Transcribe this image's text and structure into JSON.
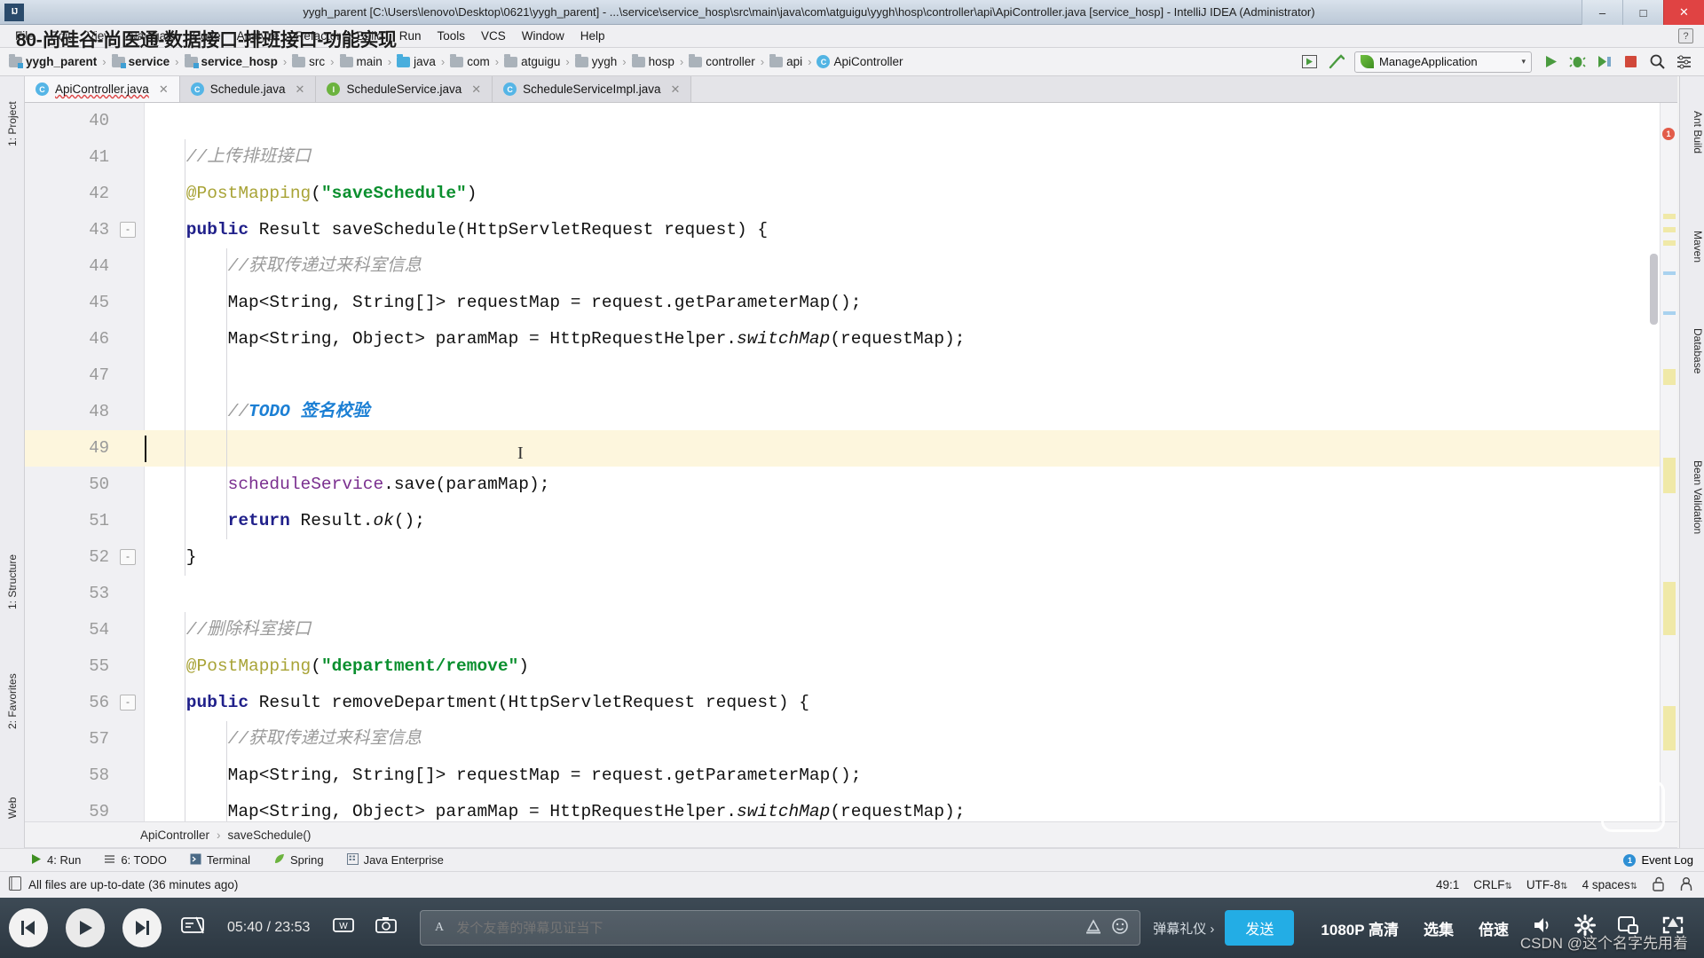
{
  "window": {
    "title": "yygh_parent [C:\\Users\\lenovo\\Desktop\\0621\\yygh_parent] - ...\\service\\service_hosp\\src\\main\\java\\com\\atguigu\\yygh\\hosp\\controller\\api\\ApiController.java [service_hosp] - IntelliJ IDEA (Administrator)",
    "app_icon": "IJ",
    "minimize": "–",
    "maximize": "□",
    "close": "✕"
  },
  "menubar": {
    "items": [
      "File",
      "Edit",
      "View",
      "Navigate",
      "Code",
      "Analyze",
      "Refactor",
      "Build",
      "Run",
      "Tools",
      "VCS",
      "Window",
      "Help"
    ],
    "help_icon": "?"
  },
  "video_overlay": {
    "title": "80-尚硅谷-尚医通-数据接口-排班接口-功能实现"
  },
  "navbar": {
    "crumbs": [
      {
        "label": "yygh_parent",
        "icon": "folder-module-icon",
        "bold": true,
        "style": "module"
      },
      {
        "label": "service",
        "icon": "folder-module-icon",
        "bold": true,
        "style": "module"
      },
      {
        "label": "service_hosp",
        "icon": "folder-module-icon",
        "bold": true,
        "style": "module"
      },
      {
        "label": "src",
        "icon": "folder-icon",
        "bold": false,
        "style": "plain"
      },
      {
        "label": "main",
        "icon": "folder-icon",
        "bold": false,
        "style": "plain"
      },
      {
        "label": "java",
        "icon": "folder-source-icon",
        "bold": false,
        "style": "source"
      },
      {
        "label": "com",
        "icon": "folder-icon",
        "bold": false,
        "style": "plain"
      },
      {
        "label": "atguigu",
        "icon": "folder-icon",
        "bold": false,
        "style": "plain"
      },
      {
        "label": "yygh",
        "icon": "folder-icon",
        "bold": false,
        "style": "plain"
      },
      {
        "label": "hosp",
        "icon": "folder-icon",
        "bold": false,
        "style": "plain"
      },
      {
        "label": "controller",
        "icon": "folder-icon",
        "bold": false,
        "style": "plain"
      },
      {
        "label": "api",
        "icon": "folder-icon",
        "bold": false,
        "style": "plain"
      },
      {
        "label": "ApiController",
        "icon": "java-class-icon",
        "bold": false,
        "style": "class"
      }
    ],
    "separator": "›",
    "run_config": "ManageApplication",
    "run_config_chevron": "▾",
    "class_letter": "C"
  },
  "editor_tabs": [
    {
      "label": "ApiController.java",
      "icon": "java-class-icon",
      "icon_letter": "C",
      "active": true,
      "close": "✕"
    },
    {
      "label": "Schedule.java",
      "icon": "java-class-icon",
      "icon_letter": "C",
      "active": false,
      "close": "✕"
    },
    {
      "label": "ScheduleService.java",
      "icon": "java-interface-icon",
      "icon_letter": "I",
      "active": false,
      "close": "✕"
    },
    {
      "label": "ScheduleServiceImpl.java",
      "icon": "java-class-icon",
      "icon_letter": "C",
      "active": false,
      "close": "✕"
    }
  ],
  "left_strip": [
    {
      "label": "1: Project"
    },
    {
      "label": "1: Structure"
    },
    {
      "label": "2: Favorites"
    },
    {
      "label": "Web"
    }
  ],
  "right_strip": [
    {
      "label": "Ant Build"
    },
    {
      "label": "Maven"
    },
    {
      "label": "Database"
    },
    {
      "label": "Bean Validation"
    }
  ],
  "code": {
    "first_line": 40,
    "error_count": "1",
    "lines": [
      {
        "no": "40",
        "fold": null,
        "highlight": false,
        "indent": 0,
        "tokens": []
      },
      {
        "no": "41",
        "fold": null,
        "highlight": false,
        "indent": 1,
        "tokens": [
          {
            "t": "comment",
            "s": "    //上传排班接口"
          }
        ]
      },
      {
        "no": "42",
        "fold": null,
        "highlight": false,
        "indent": 1,
        "tokens": [
          {
            "t": "ann",
            "s": "    @PostMapping"
          },
          {
            "t": "plain",
            "s": "("
          },
          {
            "t": "str",
            "s": "\"saveSchedule\""
          },
          {
            "t": "plain",
            "s": ")"
          }
        ]
      },
      {
        "no": "43",
        "fold": "-",
        "highlight": false,
        "indent": 1,
        "tokens": [
          {
            "t": "kw",
            "s": "    public"
          },
          {
            "t": "plain",
            "s": " Result saveSchedule(HttpServletRequest request) {"
          }
        ]
      },
      {
        "no": "44",
        "fold": null,
        "highlight": false,
        "indent": 2,
        "tokens": [
          {
            "t": "comment",
            "s": "        //获取传递过来科室信息"
          }
        ]
      },
      {
        "no": "45",
        "fold": null,
        "highlight": false,
        "indent": 2,
        "tokens": [
          {
            "t": "plain",
            "s": "        Map<String, String[]> requestMap = request.getParameterMap();"
          }
        ]
      },
      {
        "no": "46",
        "fold": null,
        "highlight": false,
        "indent": 2,
        "tokens": [
          {
            "t": "plain",
            "s": "        Map<String, Object> paramMap = HttpRequestHelper."
          },
          {
            "t": "static",
            "s": "switchMap"
          },
          {
            "t": "plain",
            "s": "(requestMap);"
          }
        ]
      },
      {
        "no": "47",
        "fold": null,
        "highlight": false,
        "indent": 2,
        "tokens": []
      },
      {
        "no": "48",
        "fold": null,
        "highlight": false,
        "indent": 2,
        "tokens": [
          {
            "t": "comment",
            "s": "        //"
          },
          {
            "t": "todo",
            "s": "TODO 签名校验"
          }
        ]
      },
      {
        "no": "49",
        "fold": null,
        "highlight": true,
        "indent": 2,
        "caret": true,
        "tokens": []
      },
      {
        "no": "50",
        "fold": null,
        "highlight": false,
        "indent": 2,
        "tokens": [
          {
            "t": "field",
            "s": "        scheduleService"
          },
          {
            "t": "plain",
            "s": "."
          },
          {
            "t": "method",
            "s": "save"
          },
          {
            "t": "plain",
            "s": "(paramMap);"
          }
        ]
      },
      {
        "no": "51",
        "fold": null,
        "highlight": false,
        "indent": 2,
        "tokens": [
          {
            "t": "kw",
            "s": "        return"
          },
          {
            "t": "plain",
            "s": " Result."
          },
          {
            "t": "static",
            "s": "ok"
          },
          {
            "t": "plain",
            "s": "();"
          }
        ]
      },
      {
        "no": "52",
        "fold": "-",
        "highlight": false,
        "indent": 1,
        "tokens": [
          {
            "t": "plain",
            "s": "    }"
          }
        ]
      },
      {
        "no": "53",
        "fold": null,
        "highlight": false,
        "indent": 0,
        "tokens": []
      },
      {
        "no": "54",
        "fold": null,
        "highlight": false,
        "indent": 1,
        "tokens": [
          {
            "t": "comment",
            "s": "    //删除科室接口"
          }
        ]
      },
      {
        "no": "55",
        "fold": null,
        "highlight": false,
        "indent": 1,
        "tokens": [
          {
            "t": "ann",
            "s": "    @PostMapping"
          },
          {
            "t": "plain",
            "s": "("
          },
          {
            "t": "str",
            "s": "\"department/remove\""
          },
          {
            "t": "plain",
            "s": ")"
          }
        ]
      },
      {
        "no": "56",
        "fold": "-",
        "highlight": false,
        "indent": 1,
        "tokens": [
          {
            "t": "kw",
            "s": "    public"
          },
          {
            "t": "plain",
            "s": " Result removeDepartment(HttpServletRequest request) {"
          }
        ]
      },
      {
        "no": "57",
        "fold": null,
        "highlight": false,
        "indent": 2,
        "tokens": [
          {
            "t": "comment",
            "s": "        //获取传递过来科室信息"
          }
        ]
      },
      {
        "no": "58",
        "fold": null,
        "highlight": false,
        "indent": 2,
        "tokens": [
          {
            "t": "plain",
            "s": "        Map<String, String[]> requestMap = request.getParameterMap();"
          }
        ]
      },
      {
        "no": "59",
        "fold": null,
        "highlight": false,
        "indent": 2,
        "clipped": true,
        "tokens": [
          {
            "t": "plain",
            "s": "        Map<String, Object> paramMap = HttpRequestHelper."
          },
          {
            "t": "static",
            "s": "switchMap"
          },
          {
            "t": "plain",
            "s": "(requestMap);"
          }
        ]
      }
    ]
  },
  "editor_breadcrumb": {
    "items": [
      "ApiController",
      "saveSchedule()"
    ],
    "separator": "›"
  },
  "tool_windows": [
    {
      "label": "4: Run",
      "icon": "run-icon"
    },
    {
      "label": "6: TODO",
      "icon": "todo-icon"
    },
    {
      "label": "Terminal",
      "icon": "terminal-icon"
    },
    {
      "label": "Spring",
      "icon": "spring-icon"
    },
    {
      "label": "Java Enterprise",
      "icon": "java-enterprise-icon"
    }
  ],
  "tool_windows_right": {
    "label": "Event Log",
    "badge": "1"
  },
  "statusbar": {
    "message": "All files are up-to-date (36 minutes ago)",
    "caret_position": "49:1",
    "line_separator": "CRLF",
    "encoding": "UTF-8",
    "indent": "4 spaces",
    "spinner": "⇅",
    "lock_icon": "lock-open-icon",
    "inspection_icon": "inspector-icon"
  },
  "player": {
    "prev_icon": "previous-track-icon",
    "play_icon": "play-icon",
    "next_icon": "next-track-icon",
    "time": "05:40 / 23:53",
    "danmu_switch_icon": "danmaku-toggle-icon",
    "word_icon": "danmaku-style-icon",
    "screenshot_icon": "screenshot-icon",
    "font_icon": "font-size-icon",
    "placeholder": "发个友善的弹幕见证当下",
    "color_icon": "color-picker-icon",
    "emoji_icon": "emoji-icon",
    "etiquette": "弹幕礼仪 ›",
    "send_label": "发送",
    "quality": "1080P 高清",
    "episodes": "选集",
    "speed": "倍速",
    "volume_icon": "volume-icon",
    "settings_icon": "gear-icon",
    "pip_icon": "picture-in-picture-icon",
    "fullscreen_icon": "fullscreen-icon"
  },
  "watermark": {
    "text": "CSDN @这个名字先用着"
  },
  "colors": {
    "accent_blue": "#23ade5",
    "string_green": "#0a8f2e",
    "keyword_navy": "#20208a",
    "annotation_olive": "#a8a336",
    "todo_blue": "#1b7fd4",
    "comment_gray": "#9a9a9a",
    "highlight_line": "#fdf6dd",
    "close_red": "#e04343"
  }
}
